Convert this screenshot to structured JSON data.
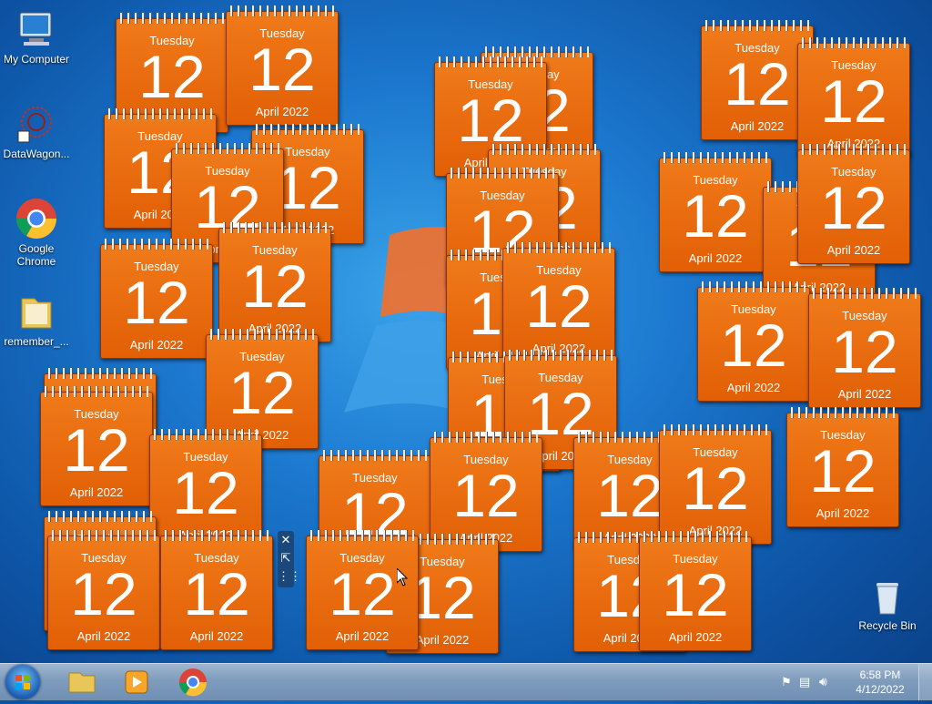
{
  "desktop_icons": [
    {
      "label": "My Computer",
      "icon": "computer-icon"
    },
    {
      "label": "DataWagon...",
      "icon": "datawagon-icon"
    },
    {
      "label": "Google Chrome",
      "icon": "chrome-icon"
    },
    {
      "label": "remember_...",
      "icon": "folder-icon"
    },
    {
      "label": "Recycle Bin",
      "icon": "recycle-bin-icon"
    }
  ],
  "calendar": {
    "weekday": "Tuesday",
    "day": "12",
    "month_year": "April 2022"
  },
  "taskbar": {
    "pinned": [
      {
        "name": "windows-explorer",
        "icon": "folder-icon"
      },
      {
        "name": "media-player",
        "icon": "media-player-icon"
      },
      {
        "name": "chrome",
        "icon": "chrome-icon"
      }
    ],
    "clock": {
      "time": "6:58 PM",
      "date": "4/12/2022"
    }
  },
  "colors": {
    "gadget_orange": "#e8680d",
    "taskbar": "#7f9cbd"
  }
}
